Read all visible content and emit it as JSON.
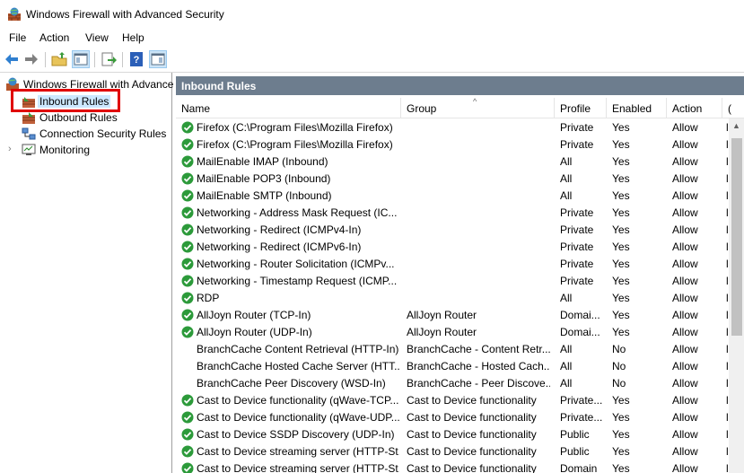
{
  "window": {
    "title": "Windows Firewall with Advanced Security"
  },
  "menu": [
    "File",
    "Action",
    "View",
    "Help"
  ],
  "toolbar_icons": [
    "back-icon",
    "forward-icon",
    "up-folder-icon",
    "show-hide-tree-icon",
    "export-icon",
    "help-icon",
    "show-hide-action-pane-icon"
  ],
  "tree": {
    "root": "Windows Firewall with Advance",
    "items": [
      "Inbound Rules",
      "Outbound Rules",
      "Connection Security Rules",
      "Monitoring"
    ]
  },
  "pane": {
    "title": "Inbound Rules"
  },
  "columns": [
    "Name",
    "Group",
    "Profile",
    "Enabled",
    "Action",
    "("
  ],
  "rows": [
    {
      "name": "Firefox (C:\\Program Files\\Mozilla Firefox)",
      "group": "",
      "profile": "Private",
      "enabled": "Yes",
      "action": "Allow",
      "extra": "l",
      "check": true
    },
    {
      "name": "Firefox (C:\\Program Files\\Mozilla Firefox)",
      "group": "",
      "profile": "Private",
      "enabled": "Yes",
      "action": "Allow",
      "extra": "l",
      "check": true
    },
    {
      "name": "MailEnable IMAP (Inbound)",
      "group": "",
      "profile": "All",
      "enabled": "Yes",
      "action": "Allow",
      "extra": "l",
      "check": true
    },
    {
      "name": "MailEnable POP3 (Inbound)",
      "group": "",
      "profile": "All",
      "enabled": "Yes",
      "action": "Allow",
      "extra": "l",
      "check": true
    },
    {
      "name": "MailEnable SMTP (Inbound)",
      "group": "",
      "profile": "All",
      "enabled": "Yes",
      "action": "Allow",
      "extra": "l",
      "check": true
    },
    {
      "name": "Networking - Address Mask Request (IC...",
      "group": "",
      "profile": "Private",
      "enabled": "Yes",
      "action": "Allow",
      "extra": "l",
      "check": true
    },
    {
      "name": "Networking - Redirect (ICMPv4-In)",
      "group": "",
      "profile": "Private",
      "enabled": "Yes",
      "action": "Allow",
      "extra": "l",
      "check": true
    },
    {
      "name": "Networking - Redirect (ICMPv6-In)",
      "group": "",
      "profile": "Private",
      "enabled": "Yes",
      "action": "Allow",
      "extra": "l",
      "check": true
    },
    {
      "name": "Networking - Router Solicitation (ICMPv...",
      "group": "",
      "profile": "Private",
      "enabled": "Yes",
      "action": "Allow",
      "extra": "l",
      "check": true
    },
    {
      "name": "Networking - Timestamp Request (ICMP...",
      "group": "",
      "profile": "Private",
      "enabled": "Yes",
      "action": "Allow",
      "extra": "l",
      "check": true
    },
    {
      "name": "RDP",
      "group": "",
      "profile": "All",
      "enabled": "Yes",
      "action": "Allow",
      "extra": "l",
      "check": true
    },
    {
      "name": "AllJoyn Router (TCP-In)",
      "group": "AllJoyn Router",
      "profile": "Domai...",
      "enabled": "Yes",
      "action": "Allow",
      "extra": "l",
      "check": true
    },
    {
      "name": "AllJoyn Router (UDP-In)",
      "group": "AllJoyn Router",
      "profile": "Domai...",
      "enabled": "Yes",
      "action": "Allow",
      "extra": "l",
      "check": true
    },
    {
      "name": "BranchCache Content Retrieval (HTTP-In)",
      "group": "BranchCache - Content Retr...",
      "profile": "All",
      "enabled": "No",
      "action": "Allow",
      "extra": "l",
      "check": false
    },
    {
      "name": "BranchCache Hosted Cache Server (HTT...",
      "group": "BranchCache - Hosted Cach...",
      "profile": "All",
      "enabled": "No",
      "action": "Allow",
      "extra": "l",
      "check": false
    },
    {
      "name": "BranchCache Peer Discovery (WSD-In)",
      "group": "BranchCache - Peer Discove...",
      "profile": "All",
      "enabled": "No",
      "action": "Allow",
      "extra": "l",
      "check": false
    },
    {
      "name": "Cast to Device functionality (qWave-TCP...",
      "group": "Cast to Device functionality",
      "profile": "Private...",
      "enabled": "Yes",
      "action": "Allow",
      "extra": "l",
      "check": true
    },
    {
      "name": "Cast to Device functionality (qWave-UDP...",
      "group": "Cast to Device functionality",
      "profile": "Private...",
      "enabled": "Yes",
      "action": "Allow",
      "extra": "l",
      "check": true
    },
    {
      "name": "Cast to Device SSDP Discovery (UDP-In)",
      "group": "Cast to Device functionality",
      "profile": "Public",
      "enabled": "Yes",
      "action": "Allow",
      "extra": "l",
      "check": true
    },
    {
      "name": "Cast to Device streaming server (HTTP-St...",
      "group": "Cast to Device functionality",
      "profile": "Public",
      "enabled": "Yes",
      "action": "Allow",
      "extra": "l",
      "check": true
    },
    {
      "name": "Cast to Device streaming server (HTTP-St...",
      "group": "Cast to Device functionality",
      "profile": "Domain",
      "enabled": "Yes",
      "action": "Allow",
      "extra": "l",
      "check": true
    }
  ],
  "colors": {
    "pane_header": "#6d7d8e",
    "check_green": "#2c9a3a",
    "highlight_box": "#e00000"
  }
}
